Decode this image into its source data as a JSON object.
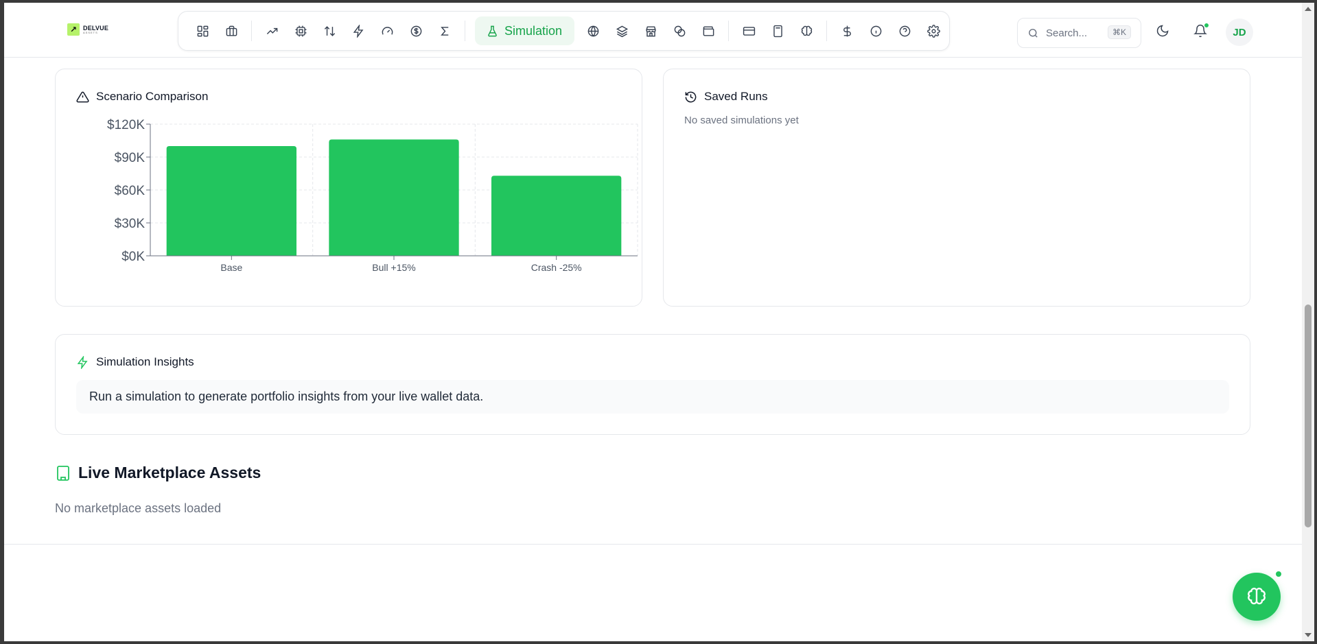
{
  "brand": {
    "name": "DELVUE",
    "tagline": "ASSETS",
    "accent": "#22c55e"
  },
  "toolbar": {
    "active_label": "Simulation",
    "icons": [
      "dashboard-icon",
      "briefcase-icon",
      "trending-up-icon",
      "cpu-icon",
      "arrows-up-down-icon",
      "zap-icon",
      "gauge-icon",
      "dollar-circle-icon",
      "sigma-icon",
      "flask-icon",
      "globe-icon",
      "layers-icon",
      "store-icon",
      "coins-icon",
      "wallet-icon",
      "credit-card-icon",
      "calculator-icon",
      "brain-icon",
      "dollar-icon",
      "info-icon",
      "help-icon",
      "gear-icon"
    ]
  },
  "search": {
    "placeholder": "Search...",
    "shortcut": "⌘K"
  },
  "user": {
    "initials": "JD"
  },
  "scenario": {
    "title": "Scenario Comparison"
  },
  "saved_runs": {
    "title": "Saved Runs",
    "empty": "No saved simulations yet"
  },
  "insights": {
    "title": "Simulation Insights",
    "text": "Run a simulation to generate portfolio insights from your live wallet data."
  },
  "marketplace": {
    "title": "Live Marketplace Assets",
    "empty": "No marketplace assets loaded"
  },
  "chart_data": {
    "type": "bar",
    "categories": [
      "Base",
      "Bull +15%",
      "Crash -25%"
    ],
    "values": [
      100000,
      106000,
      73000
    ],
    "yticks": [
      "$0K",
      "$30K",
      "$60K",
      "$90K",
      "$120K"
    ],
    "ylim": [
      0,
      120000
    ],
    "grid": true,
    "bar_color": "#22c55e"
  }
}
